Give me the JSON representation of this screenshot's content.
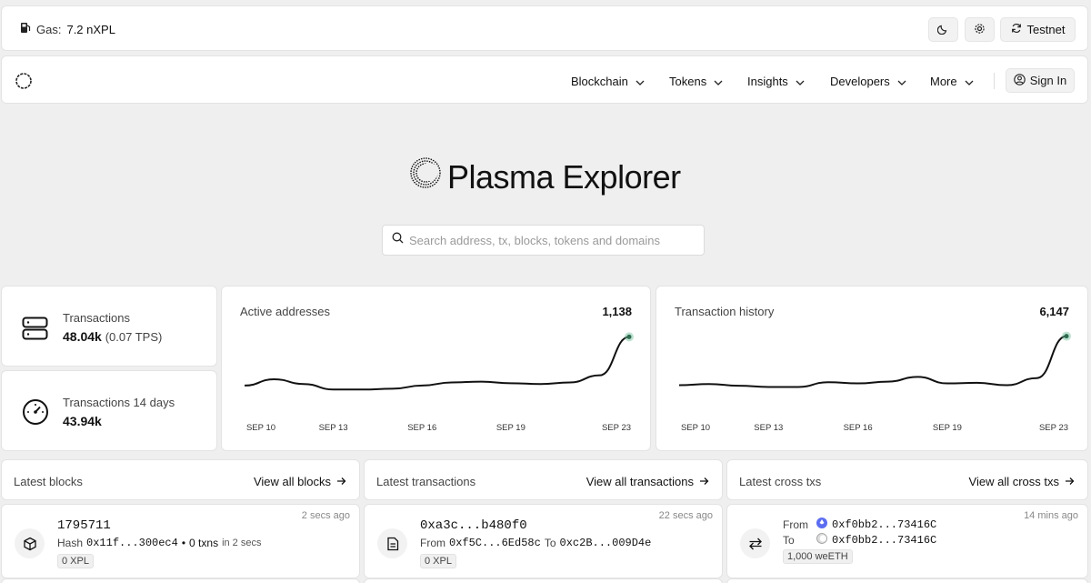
{
  "topbar": {
    "gas_label": "Gas:",
    "gas_value": "7.2 nXPL",
    "network_label": "Testnet",
    "icons": [
      "fuel-icon",
      "moon-icon",
      "gear-icon",
      "refresh-icon"
    ]
  },
  "nav": {
    "items": [
      {
        "label": "Blockchain"
      },
      {
        "label": "Tokens"
      },
      {
        "label": "Insights"
      },
      {
        "label": "Developers"
      },
      {
        "label": "More"
      }
    ],
    "signin_label": "Sign In"
  },
  "hero": {
    "title": "Plasma Explorer",
    "search_placeholder": "Search address, tx, blocks, tokens and domains"
  },
  "stats": [
    {
      "label": "Transactions",
      "value": "48.04k",
      "sub": "(0.07 TPS)",
      "icon": "server-icon"
    },
    {
      "label": "Transactions 14 days",
      "value": "43.94k",
      "sub": "",
      "icon": "gauge-icon"
    }
  ],
  "charts": {
    "active_addresses": {
      "title": "Active addresses",
      "value": "1,138",
      "ticks": [
        "SEP 10",
        "SEP 13",
        "SEP 16",
        "SEP 19",
        "SEP 23"
      ]
    },
    "tx_history": {
      "title": "Transaction history",
      "value": "6,147",
      "ticks": [
        "SEP 10",
        "SEP 13",
        "SEP 16",
        "SEP 19",
        "SEP 23"
      ]
    }
  },
  "chart_data": [
    {
      "type": "line",
      "title": "Active addresses",
      "x": [
        "SEP 10",
        "SEP 11",
        "SEP 12",
        "SEP 13",
        "SEP 14",
        "SEP 15",
        "SEP 16",
        "SEP 17",
        "SEP 18",
        "SEP 19",
        "SEP 20",
        "SEP 21",
        "SEP 22",
        "SEP 23"
      ],
      "values": [
        520,
        600,
        540,
        470,
        470,
        480,
        520,
        560,
        570,
        550,
        540,
        560,
        650,
        1138
      ],
      "ylim": [
        300,
        1200
      ]
    },
    {
      "type": "line",
      "title": "Transaction history",
      "x": [
        "SEP 10",
        "SEP 11",
        "SEP 12",
        "SEP 13",
        "SEP 14",
        "SEP 15",
        "SEP 16",
        "SEP 17",
        "SEP 18",
        "SEP 19",
        "SEP 20",
        "SEP 21",
        "SEP 22",
        "SEP 23"
      ],
      "values": [
        2000,
        2100,
        1950,
        1850,
        1850,
        2250,
        2150,
        2300,
        2700,
        2150,
        2200,
        2000,
        2600,
        6147
      ],
      "ylim": [
        500,
        6500
      ]
    }
  ],
  "panels": {
    "blocks": {
      "title": "Latest blocks",
      "link": "View all blocks"
    },
    "txs": {
      "title": "Latest transactions",
      "link": "View all transactions"
    },
    "cross": {
      "title": "Latest cross txs",
      "link": "View all cross txs"
    }
  },
  "block_row": {
    "number": "1795711",
    "time": "2 secs ago",
    "hash_label": "Hash",
    "hash": "0x11f...300ec4",
    "txns": "0 txns",
    "in": "in 2 secs",
    "reward": "0 XPL"
  },
  "tx_row": {
    "hash": "0xa3c...b480f0",
    "time": "22 secs ago",
    "from_label": "From",
    "from": "0xf5C...6Ed58c",
    "to_label": "To",
    "to": "0xc2B...009D4e",
    "value": "0 XPL"
  },
  "cross_row": {
    "time": "14 mins ago",
    "from_label": "From",
    "from": "0xf0bb2...73416C",
    "to_label": "To",
    "to": "0xf0bb2...73416C",
    "amount": "1,000 weETH"
  },
  "colors": {
    "line": "#111111",
    "dot": "#6fbf9a",
    "bg": "#efefef"
  }
}
